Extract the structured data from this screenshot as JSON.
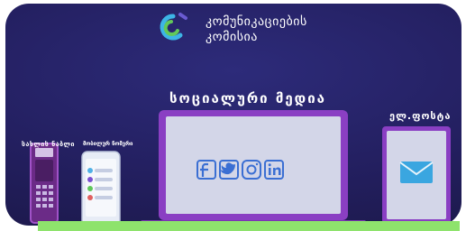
{
  "logo": {
    "line1": "კომუნიკაციების",
    "line2": "კომისია"
  },
  "headings": {
    "main": "სოციალური მედია",
    "home_phone": "სახლის ნაბლი",
    "mobile": "მობილურ ნომერი",
    "post": "ელ.ფოსტა"
  },
  "icons": {
    "social": [
      "facebook-icon",
      "twitter-icon",
      "instagram-icon",
      "linkedin-icon"
    ],
    "mail": "envelope-icon"
  },
  "colors": {
    "background": "#231f5f",
    "accent_purple": "#8a3fc3",
    "screen": "#d3d6e8",
    "social_blue": "#3b6fd3",
    "mail_blue": "#3aa6e0",
    "green": "#8ee36c"
  }
}
